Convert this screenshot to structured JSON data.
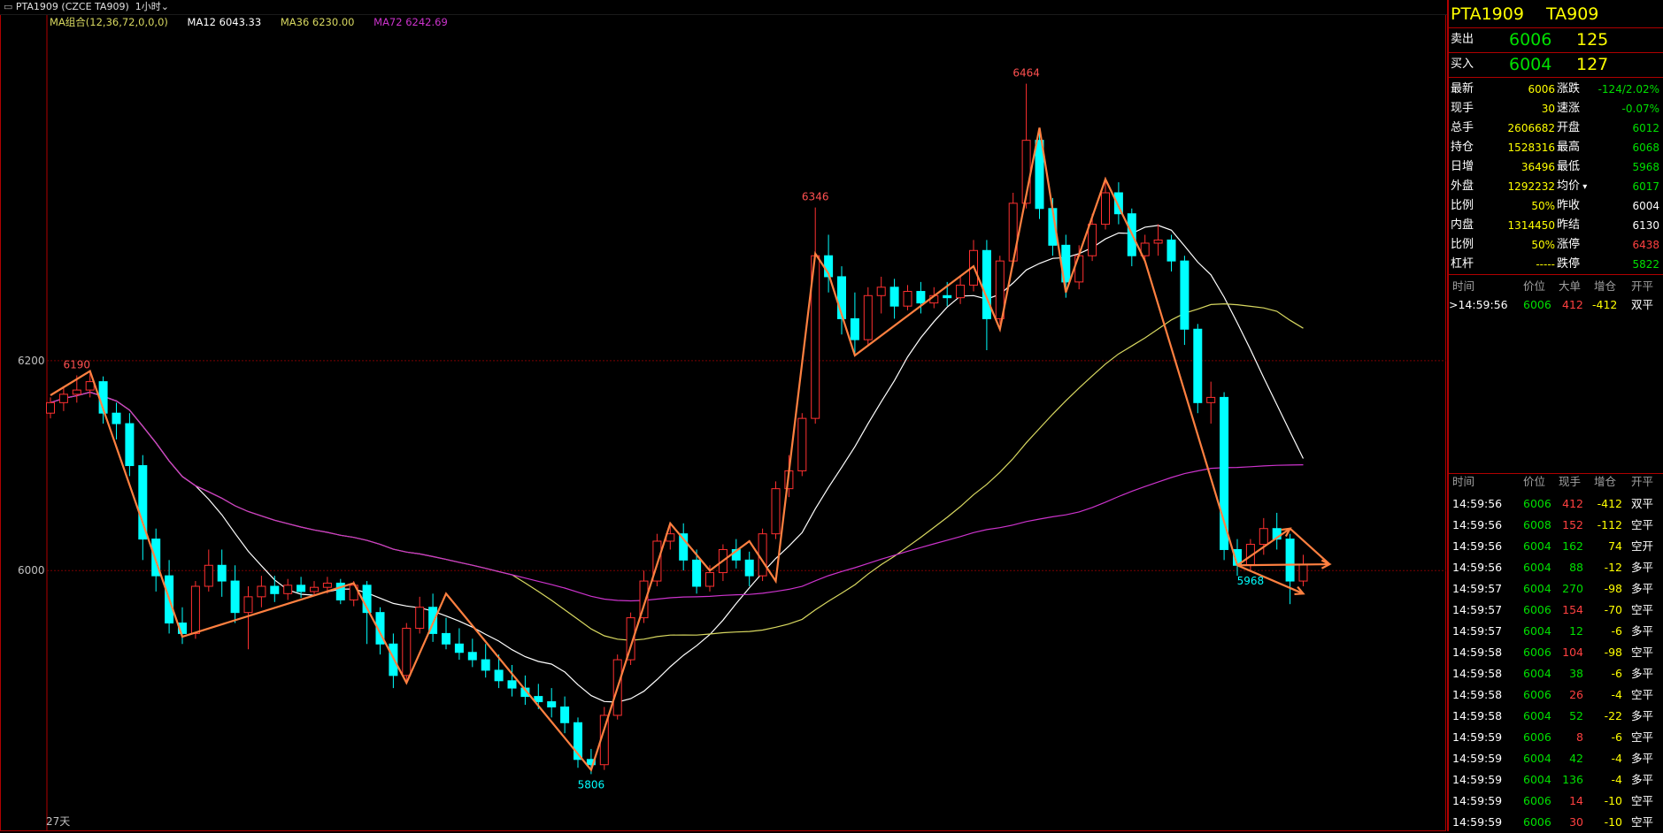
{
  "topbar": {
    "symbol": "PTA1909 (CZCE TA909)",
    "period": "1小时"
  },
  "ma_legend": {
    "group": "MA组合(12,36,72,0,0,0)",
    "ma12": "MA12 6043.33",
    "ma36": "MA36 6230.00",
    "ma72": "MA72 6242.69"
  },
  "colors": {
    "up": "#ff3030",
    "down": "#00ffff",
    "ma12": "#ffffff",
    "ma36": "#d8d860",
    "ma72": "#cc33cc",
    "zigzag": "#ff8040",
    "frame": "#b00000"
  },
  "panel": {
    "title_left": "PTA1909",
    "title_right": "TA909",
    "sell_label": "卖出",
    "sell_price": "6006",
    "sell_qty": "125",
    "buy_label": "买入",
    "buy_price": "6004",
    "buy_qty": "127",
    "stats": [
      {
        "l1": "最新",
        "v1": "6006",
        "c1": "yellow",
        "l2": "涨跌",
        "v2": "-124/2.02%",
        "c2": "green"
      },
      {
        "l1": "现手",
        "v1": "30",
        "c1": "yellow",
        "l2": "速涨",
        "v2": "-0.07%",
        "c2": "green"
      },
      {
        "l1": "总手",
        "v1": "2606682",
        "c1": "yellow",
        "l2": "开盘",
        "v2": "6012",
        "c2": "green"
      },
      {
        "l1": "持仓",
        "v1": "1528316",
        "c1": "yellow",
        "l2": "最高",
        "v2": "6068",
        "c2": "green"
      },
      {
        "l1": "日增",
        "v1": "36496",
        "c1": "yellow",
        "l2": "最低",
        "v2": "5968",
        "c2": "green"
      },
      {
        "l1": "外盘",
        "v1": "1292232",
        "c1": "yellow",
        "l2": "均价",
        "v2": "6017",
        "c2": "green"
      },
      {
        "l1": "比例",
        "v1": "50%",
        "c1": "yellow",
        "l2": "昨收",
        "v2": "6004",
        "c2": "white"
      },
      {
        "l1": "内盘",
        "v1": "1314450",
        "c1": "yellow",
        "l2": "昨结",
        "v2": "6130",
        "c2": "white"
      },
      {
        "l1": "比例",
        "v1": "50%",
        "c1": "yellow",
        "l2": "涨停",
        "v2": "6438",
        "c2": "red"
      },
      {
        "l1": "杠杆",
        "v1": "-----",
        "c1": "yellow",
        "l2": "跌停",
        "v2": "5822",
        "c2": "green"
      }
    ],
    "avg_arrow": "▾",
    "bigorder_header": {
      "time": "时间",
      "price": "价位",
      "big": "大单",
      "delta": "增仓",
      "type": "开平"
    },
    "bigorder_row": {
      "time": ">14:59:56",
      "price": "6006",
      "big": "412",
      "delta": "-412",
      "type": "双平"
    },
    "ticks_header": {
      "time": "时间",
      "price": "价位",
      "qty": "现手",
      "delta": "增仓",
      "type": "开平"
    },
    "ticks": [
      {
        "time": "14:59:56",
        "price": "6006",
        "qty": "412",
        "delta": "-412",
        "type": "双平",
        "qc": "red"
      },
      {
        "time": "14:59:56",
        "price": "6008",
        "qty": "152",
        "delta": "-112",
        "type": "空平",
        "qc": "red"
      },
      {
        "time": "14:59:56",
        "price": "6004",
        "qty": "162",
        "delta": "74",
        "type": "空开",
        "qc": "green"
      },
      {
        "time": "14:59:56",
        "price": "6004",
        "qty": "88",
        "delta": "-12",
        "type": "多平",
        "qc": "green"
      },
      {
        "time": "14:59:57",
        "price": "6004",
        "qty": "270",
        "delta": "-98",
        "type": "多平",
        "qc": "green"
      },
      {
        "time": "14:59:57",
        "price": "6006",
        "qty": "154",
        "delta": "-70",
        "type": "空平",
        "qc": "red"
      },
      {
        "time": "14:59:57",
        "price": "6004",
        "qty": "12",
        "delta": "-6",
        "type": "多平",
        "qc": "green"
      },
      {
        "time": "14:59:58",
        "price": "6006",
        "qty": "104",
        "delta": "-98",
        "type": "空平",
        "qc": "red"
      },
      {
        "time": "14:59:58",
        "price": "6004",
        "qty": "38",
        "delta": "-6",
        "type": "多平",
        "qc": "green"
      },
      {
        "time": "14:59:58",
        "price": "6006",
        "qty": "26",
        "delta": "-4",
        "type": "空平",
        "qc": "red"
      },
      {
        "time": "14:59:58",
        "price": "6004",
        "qty": "52",
        "delta": "-22",
        "type": "多平",
        "qc": "green"
      },
      {
        "time": "14:59:59",
        "price": "6006",
        "qty": "8",
        "delta": "-6",
        "type": "空平",
        "qc": "red"
      },
      {
        "time": "14:59:59",
        "price": "6004",
        "qty": "42",
        "delta": "-4",
        "type": "多平",
        "qc": "green"
      },
      {
        "time": "14:59:59",
        "price": "6004",
        "qty": "136",
        "delta": "-4",
        "type": "多平",
        "qc": "green"
      },
      {
        "time": "14:59:59",
        "price": "6006",
        "qty": "14",
        "delta": "-10",
        "type": "空平",
        "qc": "red"
      },
      {
        "time": "14:59:59",
        "price": "6006",
        "qty": "30",
        "delta": "-10",
        "type": "空平",
        "qc": "red"
      }
    ]
  },
  "chart_data": {
    "type": "candlestick",
    "ylim": [
      5760,
      6510
    ],
    "y_ticks": [
      6000,
      6200
    ],
    "y_tick_labels": [
      "6000",
      "6200"
    ],
    "bottom_label": "27天",
    "peak_labels": [
      {
        "i": 2,
        "price": 6190,
        "text": "6190",
        "pos": "above"
      },
      {
        "i": 41,
        "price": 5806,
        "text": "5806",
        "pos": "below"
      },
      {
        "i": 58,
        "price": 6346,
        "text": "6346",
        "pos": "above"
      },
      {
        "i": 74,
        "price": 6464,
        "text": "6464",
        "pos": "above"
      },
      {
        "i": 91,
        "price": 5968,
        "text": "5968",
        "pos": "below"
      }
    ],
    "zigzag": [
      {
        "i": 0,
        "price": 6167
      },
      {
        "i": 3,
        "price": 6190
      },
      {
        "i": 10,
        "price": 5937
      },
      {
        "i": 23,
        "price": 5988
      },
      {
        "i": 27,
        "price": 5893
      },
      {
        "i": 30,
        "price": 5978
      },
      {
        "i": 41,
        "price": 5810
      },
      {
        "i": 47,
        "price": 6045
      },
      {
        "i": 50,
        "price": 6000
      },
      {
        "i": 53,
        "price": 6028
      },
      {
        "i": 55,
        "price": 5990
      },
      {
        "i": 58,
        "price": 6302
      },
      {
        "i": 59,
        "price": 6283
      },
      {
        "i": 61,
        "price": 6205
      },
      {
        "i": 70,
        "price": 6290
      },
      {
        "i": 72,
        "price": 6230
      },
      {
        "i": 75,
        "price": 6422
      },
      {
        "i": 77,
        "price": 6265
      },
      {
        "i": 80,
        "price": 6373
      },
      {
        "i": 83,
        "price": 6295
      },
      {
        "i": 90,
        "price": 6005
      }
    ],
    "projections": [
      {
        "i": 94,
        "price": 6040
      },
      {
        "i": 97,
        "price": 6006
      },
      {
        "i": 95,
        "price": 5978
      }
    ],
    "candles": [
      {
        "o": 6150,
        "h": 6165,
        "c": 6160,
        "l": 6145
      },
      {
        "o": 6160,
        "h": 6175,
        "c": 6168,
        "l": 6152
      },
      {
        "o": 6168,
        "h": 6186,
        "c": 6172,
        "l": 6160
      },
      {
        "o": 6172,
        "h": 6190,
        "c": 6180,
        "l": 6165
      },
      {
        "o": 6180,
        "h": 6185,
        "c": 6150,
        "l": 6140
      },
      {
        "o": 6150,
        "h": 6160,
        "c": 6140,
        "l": 6125
      },
      {
        "o": 6140,
        "h": 6150,
        "c": 6100,
        "l": 6090
      },
      {
        "o": 6100,
        "h": 6110,
        "c": 6030,
        "l": 6010
      },
      {
        "o": 6030,
        "h": 6040,
        "c": 5995,
        "l": 5980
      },
      {
        "o": 5995,
        "h": 6010,
        "c": 5950,
        "l": 5940
      },
      {
        "o": 5950,
        "h": 5965,
        "c": 5940,
        "l": 5930
      },
      {
        "o": 5940,
        "h": 5990,
        "c": 5985,
        "l": 5935
      },
      {
        "o": 5985,
        "h": 6020,
        "c": 6005,
        "l": 5980
      },
      {
        "o": 6005,
        "h": 6020,
        "c": 5990,
        "l": 5975
      },
      {
        "o": 5990,
        "h": 6005,
        "c": 5960,
        "l": 5950
      },
      {
        "o": 5960,
        "h": 5985,
        "c": 5975,
        "l": 5925
      },
      {
        "o": 5975,
        "h": 5995,
        "c": 5985,
        "l": 5965
      },
      {
        "o": 5985,
        "h": 5995,
        "c": 5978,
        "l": 5970
      },
      {
        "o": 5978,
        "h": 5992,
        "c": 5986,
        "l": 5972
      },
      {
        "o": 5986,
        "h": 5994,
        "c": 5980,
        "l": 5974
      },
      {
        "o": 5980,
        "h": 5990,
        "c": 5984,
        "l": 5976
      },
      {
        "o": 5984,
        "h": 5994,
        "c": 5988,
        "l": 5978
      },
      {
        "o": 5988,
        "h": 5992,
        "c": 5972,
        "l": 5968
      },
      {
        "o": 5972,
        "h": 5990,
        "c": 5986,
        "l": 5966
      },
      {
        "o": 5986,
        "h": 5990,
        "c": 5960,
        "l": 5930
      },
      {
        "o": 5960,
        "h": 5965,
        "c": 5930,
        "l": 5920
      },
      {
        "o": 5930,
        "h": 5940,
        "c": 5900,
        "l": 5888
      },
      {
        "o": 5900,
        "h": 5950,
        "c": 5945,
        "l": 5895
      },
      {
        "o": 5945,
        "h": 5975,
        "c": 5965,
        "l": 5940
      },
      {
        "o": 5965,
        "h": 5978,
        "c": 5940,
        "l": 5932
      },
      {
        "o": 5940,
        "h": 5955,
        "c": 5930,
        "l": 5925
      },
      {
        "o": 5930,
        "h": 5945,
        "c": 5922,
        "l": 5915
      },
      {
        "o": 5922,
        "h": 5935,
        "c": 5915,
        "l": 5908
      },
      {
        "o": 5915,
        "h": 5930,
        "c": 5905,
        "l": 5898
      },
      {
        "o": 5905,
        "h": 5920,
        "c": 5895,
        "l": 5888
      },
      {
        "o": 5895,
        "h": 5910,
        "c": 5888,
        "l": 5880
      },
      {
        "o": 5888,
        "h": 5900,
        "c": 5880,
        "l": 5872
      },
      {
        "o": 5880,
        "h": 5892,
        "c": 5875,
        "l": 5868
      },
      {
        "o": 5875,
        "h": 5888,
        "c": 5870,
        "l": 5860
      },
      {
        "o": 5870,
        "h": 5880,
        "c": 5855,
        "l": 5845
      },
      {
        "o": 5855,
        "h": 5860,
        "c": 5820,
        "l": 5812
      },
      {
        "o": 5820,
        "h": 5830,
        "c": 5815,
        "l": 5806
      },
      {
        "o": 5815,
        "h": 5870,
        "c": 5862,
        "l": 5810
      },
      {
        "o": 5862,
        "h": 5920,
        "c": 5915,
        "l": 5858
      },
      {
        "o": 5915,
        "h": 5960,
        "c": 5955,
        "l": 5910
      },
      {
        "o": 5955,
        "h": 6000,
        "c": 5990,
        "l": 5950
      },
      {
        "o": 5990,
        "h": 6035,
        "c": 6028,
        "l": 5985
      },
      {
        "o": 6028,
        "h": 6045,
        "c": 6035,
        "l": 6020
      },
      {
        "o": 6035,
        "h": 6045,
        "c": 6010,
        "l": 6000
      },
      {
        "o": 6010,
        "h": 6020,
        "c": 5985,
        "l": 5978
      },
      {
        "o": 5985,
        "h": 6005,
        "c": 5998,
        "l": 5980
      },
      {
        "o": 5998,
        "h": 6025,
        "c": 6020,
        "l": 5990
      },
      {
        "o": 6020,
        "h": 6030,
        "c": 6010,
        "l": 6002
      },
      {
        "o": 6010,
        "h": 6018,
        "c": 5995,
        "l": 5985
      },
      {
        "o": 5995,
        "h": 6040,
        "c": 6035,
        "l": 5990
      },
      {
        "o": 6035,
        "h": 6085,
        "c": 6078,
        "l": 6030
      },
      {
        "o": 6078,
        "h": 6110,
        "c": 6095,
        "l": 6070
      },
      {
        "o": 6095,
        "h": 6150,
        "c": 6145,
        "l": 6090
      },
      {
        "o": 6145,
        "h": 6346,
        "c": 6300,
        "l": 6140
      },
      {
        "o": 6300,
        "h": 6320,
        "c": 6280,
        "l": 6265
      },
      {
        "o": 6280,
        "h": 6290,
        "c": 6240,
        "l": 6225
      },
      {
        "o": 6240,
        "h": 6265,
        "c": 6220,
        "l": 6205
      },
      {
        "o": 6220,
        "h": 6270,
        "c": 6262,
        "l": 6215
      },
      {
        "o": 6262,
        "h": 6280,
        "c": 6270,
        "l": 6245
      },
      {
        "o": 6270,
        "h": 6278,
        "c": 6252,
        "l": 6240
      },
      {
        "o": 6252,
        "h": 6272,
        "c": 6266,
        "l": 6248
      },
      {
        "o": 6266,
        "h": 6275,
        "c": 6255,
        "l": 6245
      },
      {
        "o": 6255,
        "h": 6270,
        "c": 6262,
        "l": 6250
      },
      {
        "o": 6262,
        "h": 6275,
        "c": 6260,
        "l": 6252
      },
      {
        "o": 6260,
        "h": 6280,
        "c": 6272,
        "l": 6254
      },
      {
        "o": 6272,
        "h": 6315,
        "c": 6305,
        "l": 6266
      },
      {
        "o": 6305,
        "h": 6315,
        "c": 6240,
        "l": 6210
      },
      {
        "o": 6240,
        "h": 6300,
        "c": 6295,
        "l": 6235
      },
      {
        "o": 6295,
        "h": 6360,
        "c": 6350,
        "l": 6290
      },
      {
        "o": 6350,
        "h": 6464,
        "c": 6410,
        "l": 6345
      },
      {
        "o": 6410,
        "h": 6420,
        "c": 6345,
        "l": 6335
      },
      {
        "o": 6345,
        "h": 6355,
        "c": 6310,
        "l": 6300
      },
      {
        "o": 6310,
        "h": 6320,
        "c": 6275,
        "l": 6260
      },
      {
        "o": 6275,
        "h": 6310,
        "c": 6300,
        "l": 6268
      },
      {
        "o": 6300,
        "h": 6340,
        "c": 6330,
        "l": 6295
      },
      {
        "o": 6330,
        "h": 6375,
        "c": 6360,
        "l": 6325
      },
      {
        "o": 6360,
        "h": 6370,
        "c": 6340,
        "l": 6330
      },
      {
        "o": 6340,
        "h": 6345,
        "c": 6300,
        "l": 6290
      },
      {
        "o": 6300,
        "h": 6320,
        "c": 6312,
        "l": 6295
      },
      {
        "o": 6312,
        "h": 6330,
        "c": 6315,
        "l": 6300
      },
      {
        "o": 6315,
        "h": 6320,
        "c": 6295,
        "l": 6285
      },
      {
        "o": 6295,
        "h": 6300,
        "c": 6230,
        "l": 6215
      },
      {
        "o": 6230,
        "h": 6235,
        "c": 6160,
        "l": 6150
      },
      {
        "o": 6160,
        "h": 6180,
        "c": 6165,
        "l": 6140
      },
      {
        "o": 6165,
        "h": 6170,
        "c": 6020,
        "l": 6010
      },
      {
        "o": 6020,
        "h": 6030,
        "c": 6005,
        "l": 5995
      },
      {
        "o": 6005,
        "h": 6030,
        "c": 6025,
        "l": 6000
      },
      {
        "o": 6025,
        "h": 6050,
        "c": 6040,
        "l": 6015
      },
      {
        "o": 6040,
        "h": 6055,
        "c": 6030,
        "l": 6020
      },
      {
        "o": 6030,
        "h": 6035,
        "c": 5990,
        "l": 5968
      },
      {
        "o": 5990,
        "h": 6015,
        "c": 6006,
        "l": 5985
      }
    ]
  }
}
